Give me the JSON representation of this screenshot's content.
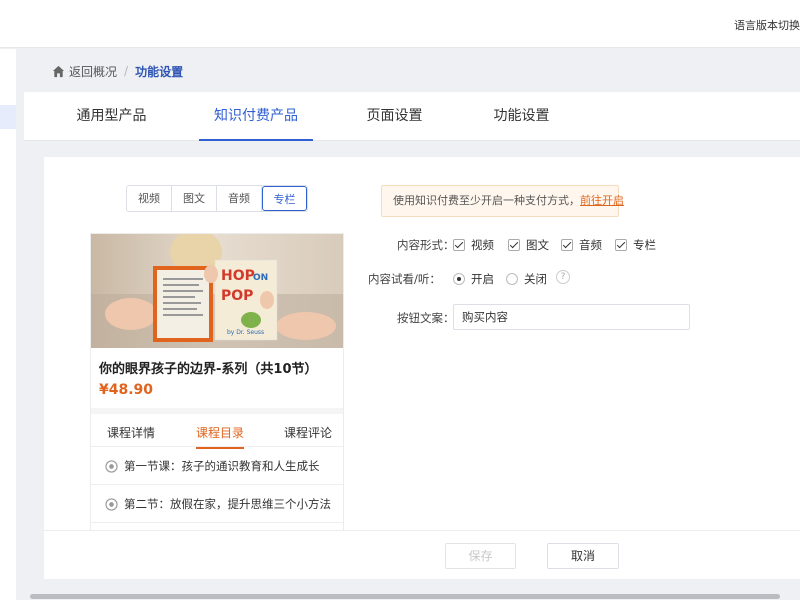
{
  "header": {
    "language_label": "语言版本切换"
  },
  "breadcrumb": {
    "back_label": "返回概况",
    "separator": "/",
    "current": "功能设置"
  },
  "tabs": [
    {
      "label": "通用型产品"
    },
    {
      "label": "知识付费产品",
      "active": true
    },
    {
      "label": "页面设置"
    },
    {
      "label": "功能设置"
    }
  ],
  "content_type_tabs": [
    {
      "label": "视频"
    },
    {
      "label": "图文"
    },
    {
      "label": "音频"
    },
    {
      "label": "专栏",
      "active": true
    }
  ],
  "preview": {
    "cover": {
      "book_title_line1": "HOP",
      "book_title_line2": "ON",
      "book_title_line3": "POP",
      "book_author": "by Dr. Seuss"
    },
    "course_title": "你的眼界孩子的边界-系列（共10节）",
    "price": "¥48.90",
    "tabs": [
      {
        "label": "课程详情"
      },
      {
        "label": "课程目录",
        "active": true
      },
      {
        "label": "课程评论"
      }
    ],
    "lessons": [
      {
        "title": "第一节课：孩子的通识教育和人生成长"
      },
      {
        "title": "第二节：放假在家，提升思维三个小方法"
      }
    ]
  },
  "notice": {
    "text": "使用知识付费至少开启一种支付方式，",
    "link": "前往开启"
  },
  "form": {
    "content_form_label": "内容形式：",
    "content_forms": [
      {
        "label": "视频",
        "checked": true
      },
      {
        "label": "图文",
        "checked": true
      },
      {
        "label": "音频",
        "checked": true
      },
      {
        "label": "专栏",
        "checked": true
      }
    ],
    "trial_label": "内容试看/听：",
    "trial_options": [
      {
        "label": "开启",
        "selected": true
      },
      {
        "label": "关闭",
        "selected": false
      }
    ],
    "help_symbol": "?",
    "button_text_label": "按钮文案：",
    "button_text_value": "购买内容"
  },
  "footer": {
    "save_label": "保存",
    "cancel_label": "取消"
  },
  "colors": {
    "primary": "#2f5fd0",
    "accent_orange": "#e0641e",
    "notice_bg": "#fff7ed",
    "page_bg": "#eef0f4"
  }
}
